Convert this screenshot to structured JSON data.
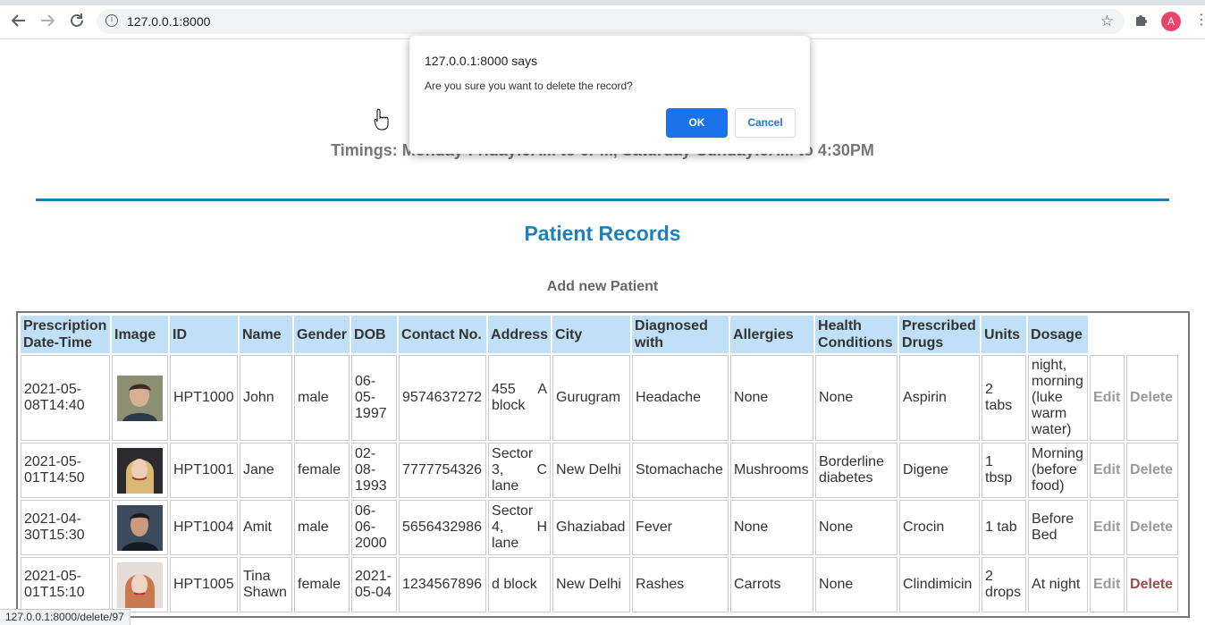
{
  "browser": {
    "url": "127.0.0.1:8000",
    "avatar_letter": "A",
    "icons": [
      "back-icon",
      "forward-icon",
      "reload-icon",
      "info-icon",
      "star-icon",
      "puzzle-icon",
      "kebab-icon"
    ]
  },
  "page": {
    "timings": "Timings: Monday-Friday:9AM to 6PM, Saturday-Sunday:9AM to 4:30PM",
    "heading": "Patient Records",
    "add_link": "Add new Patient",
    "accent_color": "#1f81b9"
  },
  "table": {
    "headers": [
      "Prescription Date-Time",
      "Image",
      "ID",
      "Name",
      "Gender",
      "DOB",
      "Contact No.",
      "Address",
      "City",
      "Diagnosed with",
      "Allergies",
      "Health Conditions",
      "Prescribed Drugs",
      "Units",
      "Dosage"
    ],
    "rows": [
      {
        "datetime": "2021-05-08T14:40",
        "id": "HPT1000",
        "name": "John",
        "gender": "male",
        "dob": "06-05-1997",
        "contact": "9574637272",
        "address": "455 A block",
        "city": "Gurugram",
        "diagnosed": "Headache",
        "allergies": "None",
        "health": "None",
        "drugs": "Aspirin",
        "units": "2 tabs",
        "dosage": "night, morning (luke warm water)",
        "edit": "Edit",
        "delete": "Delete"
      },
      {
        "datetime": "2021-05-01T14:50",
        "id": "HPT1001",
        "name": "Jane",
        "gender": "female",
        "dob": "02-08-1993",
        "contact": "7777754326",
        "address": "Sector 3, C lane",
        "city": "New Delhi",
        "diagnosed": "Stomachache",
        "allergies": "Mushrooms",
        "health": "Borderline diabetes",
        "drugs": "Digene",
        "units": "1 tbsp",
        "dosage": "Morning (before food)",
        "edit": "Edit",
        "delete": "Delete"
      },
      {
        "datetime": "2021-04-30T15:30",
        "id": "HPT1004",
        "name": "Amit",
        "gender": "male",
        "dob": "06-06-2000",
        "contact": "5656432986",
        "address": "Sector 4, H lane",
        "city": "Ghaziabad",
        "diagnosed": "Fever",
        "allergies": "None",
        "health": "None",
        "drugs": "Crocin",
        "units": "1 tab",
        "dosage": "Before Bed",
        "edit": "Edit",
        "delete": "Delete"
      },
      {
        "datetime": "2021-05-01T15:10",
        "id": "HPT1005",
        "name": "Tina Shawn",
        "gender": "female",
        "dob": "2021-05-04",
        "contact": "1234567896",
        "address": "d block",
        "city": "New Delhi",
        "diagnosed": "Rashes",
        "allergies": "Carrots",
        "health": "None",
        "drugs": "Clindimicin",
        "units": "2 drops",
        "dosage": "At night",
        "edit": "Edit",
        "delete": "Delete"
      }
    ]
  },
  "dialog": {
    "title": "127.0.0.1:8000 says",
    "message": "Are you sure you want to delete the record?",
    "ok_label": "OK",
    "cancel_label": "Cancel"
  },
  "status_bar": {
    "url": "127.0.0.1:8000/delete/97"
  }
}
